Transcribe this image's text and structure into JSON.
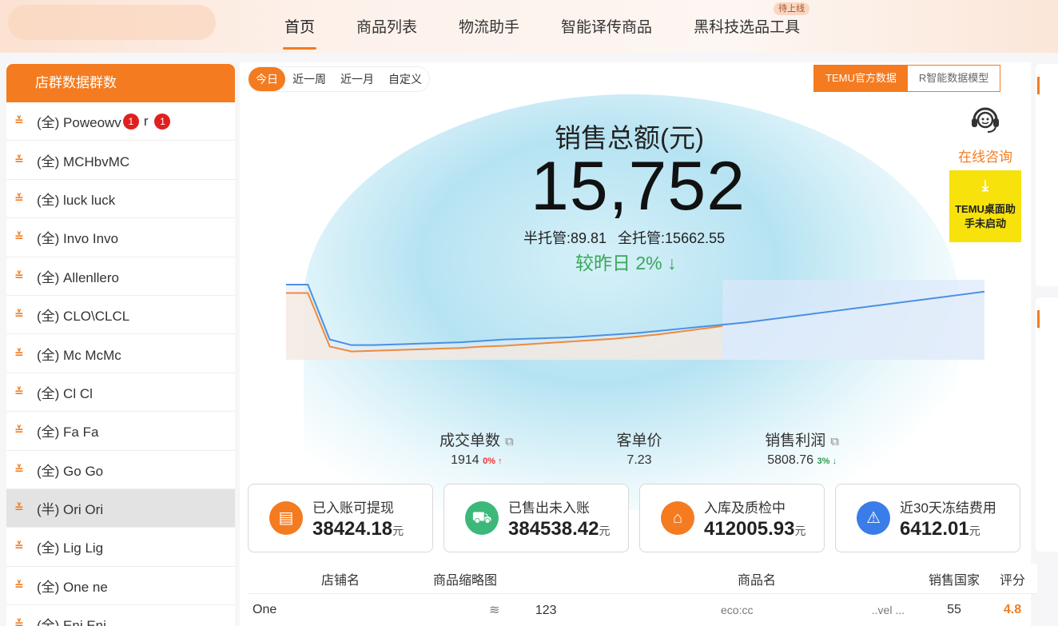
{
  "nav": {
    "tabs": [
      {
        "label": "首页"
      },
      {
        "label": "商品列表"
      },
      {
        "label": "物流助手"
      },
      {
        "label": "智能译传商品"
      },
      {
        "label": "黑科技选品工具",
        "badge": "待上线"
      }
    ]
  },
  "sidebar": {
    "title": "店群数据群数",
    "items": [
      {
        "label": "(全) Poweowv",
        "badge1": "1",
        "suffix": "r",
        "badge2": "1"
      },
      {
        "label": "(全) MCHbvMC"
      },
      {
        "label": "(全) luck luck"
      },
      {
        "label": "(全) Invo Invo"
      },
      {
        "label": "(全) Allenllero"
      },
      {
        "label": "(全) CLO\\CLCL"
      },
      {
        "label": "(全) Mc McMc"
      },
      {
        "label": "(全) Cl Cl"
      },
      {
        "label": "(全) Fa Fa"
      },
      {
        "label": "(全) Go Go"
      },
      {
        "label": "(半) Ori Ori"
      },
      {
        "label": "(全) Lig Lig"
      },
      {
        "label": "(全) One ne"
      },
      {
        "label": "(全) Eni Eni"
      }
    ]
  },
  "range_tabs": [
    "今日",
    "近一周",
    "近一月",
    "自定义"
  ],
  "source_tabs": [
    "TEMU官方数据",
    "R智能数据模型"
  ],
  "support": {
    "consult": "在线咨询",
    "launch_line1": "TEMU桌面助",
    "launch_line2": "手未启动"
  },
  "sales": {
    "title": "销售总额(元)",
    "value": "15,752",
    "semi": "半托管:89.81",
    "full": "全托管:15662.55",
    "compare": "较昨日 2%",
    "compare_arrow": "↓"
  },
  "chart_data": {
    "type": "line",
    "series": [
      {
        "values": [
          100,
          100,
          22,
          14,
          14,
          15,
          16,
          17,
          18,
          20,
          22,
          23,
          24,
          25,
          27,
          29,
          31,
          34,
          37,
          40,
          43,
          46,
          50,
          54,
          58,
          62,
          66,
          70,
          74,
          78,
          82,
          86,
          90
        ]
      },
      {
        "values": [
          88,
          88,
          12,
          5,
          6,
          7,
          8,
          9,
          10,
          12,
          13,
          15,
          17,
          19,
          21,
          23,
          26,
          29,
          33,
          37,
          41
        ]
      }
    ],
    "colors": [
      "#4a90e2",
      "#f08a3c"
    ]
  },
  "metrics": [
    {
      "label": "成交单数",
      "value": "1914",
      "change": "0%",
      "dir": "↑",
      "trend": "up"
    },
    {
      "label": "客单价",
      "value": "7.23"
    },
    {
      "label": "销售利润",
      "value": "5808.76",
      "change": "3%",
      "dir": "↓",
      "trend": "down"
    }
  ],
  "cards": [
    {
      "label": "已入账可提现",
      "value": "38424.18",
      "unit": "元",
      "color": "#f47b20"
    },
    {
      "label": "已售出未入账",
      "value": "384538.42",
      "unit": "元",
      "color": "#3cb87a"
    },
    {
      "label": "入库及质检中",
      "value": "412005.93",
      "unit": "元",
      "color": "#f47b20"
    },
    {
      "label": "近30天冻结费用",
      "value": "6412.01",
      "unit": "元",
      "color": "#3a7ce8"
    }
  ],
  "table": {
    "headers": [
      "店铺名",
      "商品缩略图",
      "商品名",
      "销售国家",
      "评分"
    ],
    "rows": [
      {
        "shop": "One",
        "thumb_code": "123",
        "name_a": "eco:cc",
        "name_b": "..vel ...",
        "country": "55",
        "score": "4.8"
      }
    ]
  }
}
